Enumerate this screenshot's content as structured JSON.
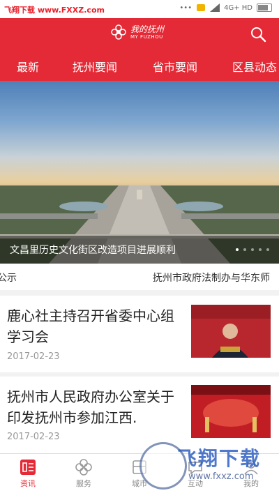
{
  "status_bar": {
    "watermark": "飞翔下载 www.FXXZ.com",
    "network": "4G+ HD"
  },
  "header": {
    "logo_cn": "我的抚州",
    "logo_en": "MY FUZHOU"
  },
  "tabs": [
    "最新",
    "抚州要闻",
    "省市要闻",
    "区县动态"
  ],
  "banner": {
    "caption": "文昌里历史文化街区改造项目进展顺利",
    "dot_count": 5,
    "active_dot": 0
  },
  "ticker": {
    "left": "公示",
    "right": "抚州市政府法制办与华东师"
  },
  "news": [
    {
      "title": "鹿心社主持召开省委中心组学习会",
      "date": "2017-02-23"
    },
    {
      "title": "抚州市人民政府办公室关于印发抚州市参加江西.",
      "date": "2017-02-23"
    }
  ],
  "tabbar": [
    {
      "label": "资讯",
      "icon": "news-icon",
      "active": true
    },
    {
      "label": "服务",
      "icon": "service-icon",
      "active": false
    },
    {
      "label": "城市",
      "icon": "city-icon",
      "active": false
    },
    {
      "label": "互动",
      "icon": "interaction-icon",
      "active": false
    },
    {
      "label": "我的",
      "icon": "user-icon",
      "active": false
    }
  ],
  "watermark_bottom": {
    "cn": "飞翔下载",
    "url": "www.fxxz.com"
  },
  "colors": {
    "brand_red": "#e32a36"
  }
}
